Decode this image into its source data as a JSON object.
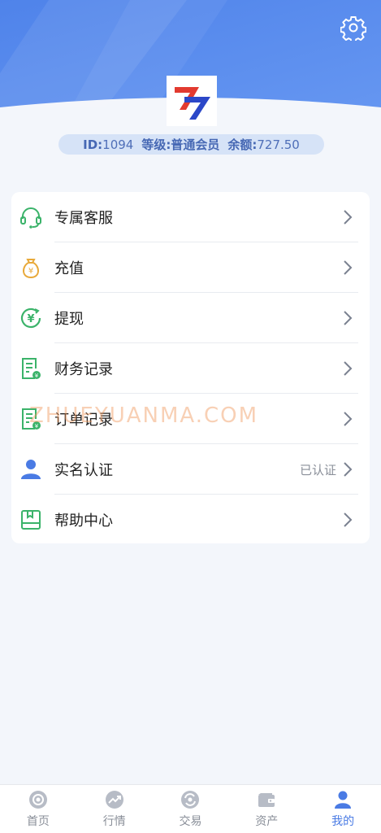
{
  "header": {
    "accent_color": "#5b8def",
    "info": {
      "id_label": "ID:",
      "id_value": "1094",
      "level_label": "等级:",
      "level_value": "普通会员",
      "balance_label": "余额:",
      "balance_value": "727.50"
    }
  },
  "menu": {
    "items": [
      {
        "label": "专属客服",
        "icon": "headset-icon",
        "status": ""
      },
      {
        "label": "充值",
        "icon": "money-bag-icon",
        "status": ""
      },
      {
        "label": "提现",
        "icon": "yen-withdraw-icon",
        "status": ""
      },
      {
        "label": "财务记录",
        "icon": "finance-record-icon",
        "status": ""
      },
      {
        "label": "订单记录",
        "icon": "order-record-icon",
        "status": ""
      },
      {
        "label": "实名认证",
        "icon": "user-icon",
        "status": "已认证"
      },
      {
        "label": "帮助中心",
        "icon": "help-book-icon",
        "status": ""
      }
    ]
  },
  "watermark": "ZHUEYUANMA.COM",
  "tabbar": {
    "items": [
      {
        "label": "首页",
        "icon": "home-icon"
      },
      {
        "label": "行情",
        "icon": "market-icon"
      },
      {
        "label": "交易",
        "icon": "trade-icon"
      },
      {
        "label": "资产",
        "icon": "wallet-icon"
      },
      {
        "label": "我的",
        "icon": "profile-icon"
      }
    ],
    "active": "我的",
    "active_color": "#4a7be4",
    "inactive_color": "#b7bcc6"
  }
}
